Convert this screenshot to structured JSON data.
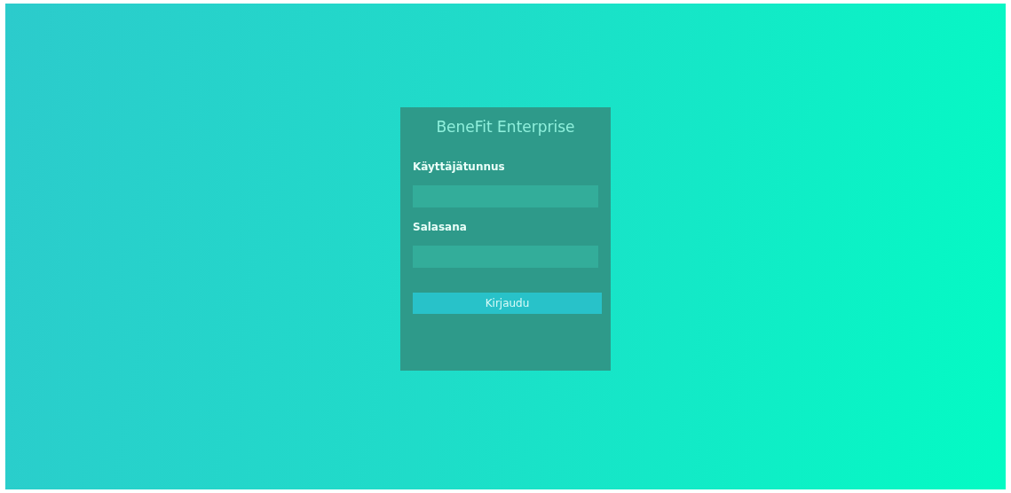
{
  "login": {
    "title": "BeneFit Enterprise",
    "fields": [
      {
        "label": "Käyttäjätunnus"
      },
      {
        "label": "Salasana"
      }
    ],
    "button": "Kirjaudu"
  }
}
